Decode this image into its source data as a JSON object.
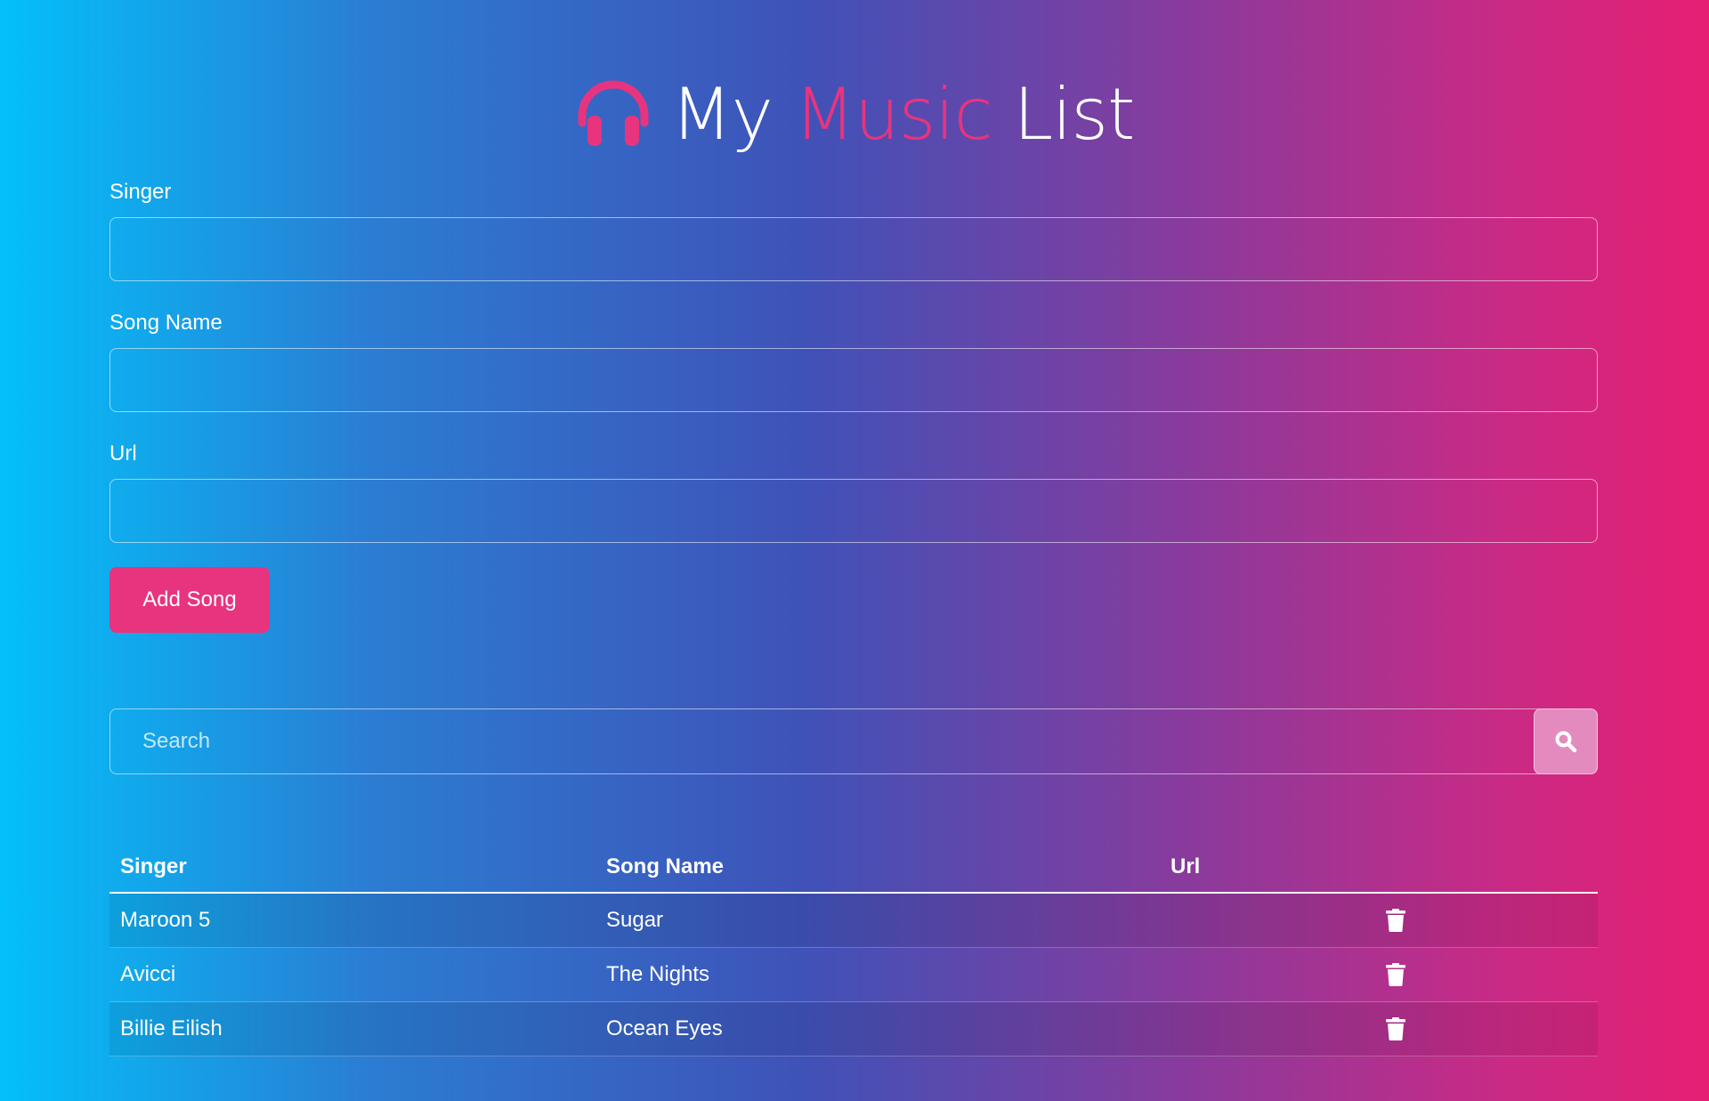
{
  "title": {
    "word1": "My",
    "word2": "Music",
    "word3": "List",
    "accent_color": "#e8347e",
    "icon": "headphones-icon"
  },
  "form": {
    "singer_label": "Singer",
    "singer_value": "",
    "song_label": "Song Name",
    "song_value": "",
    "url_label": "Url",
    "url_value": "",
    "add_button": "Add Song"
  },
  "search": {
    "placeholder": "Search",
    "icon": "search-icon"
  },
  "table": {
    "headers": [
      "Singer",
      "Song Name",
      "Url"
    ],
    "rows": [
      {
        "singer": "Maroon 5",
        "song": "Sugar",
        "url": ""
      },
      {
        "singer": "Avicci",
        "song": "The Nights",
        "url": ""
      },
      {
        "singer": "Billie Eilish",
        "song": "Ocean Eyes",
        "url": ""
      }
    ],
    "delete_icon": "trash-icon"
  },
  "colors": {
    "gradient_start": "#03c0fa",
    "gradient_mid": "#3f52b8",
    "gradient_end": "#e61f73",
    "button": "#e8347e",
    "search_button": "#e38bbf"
  }
}
